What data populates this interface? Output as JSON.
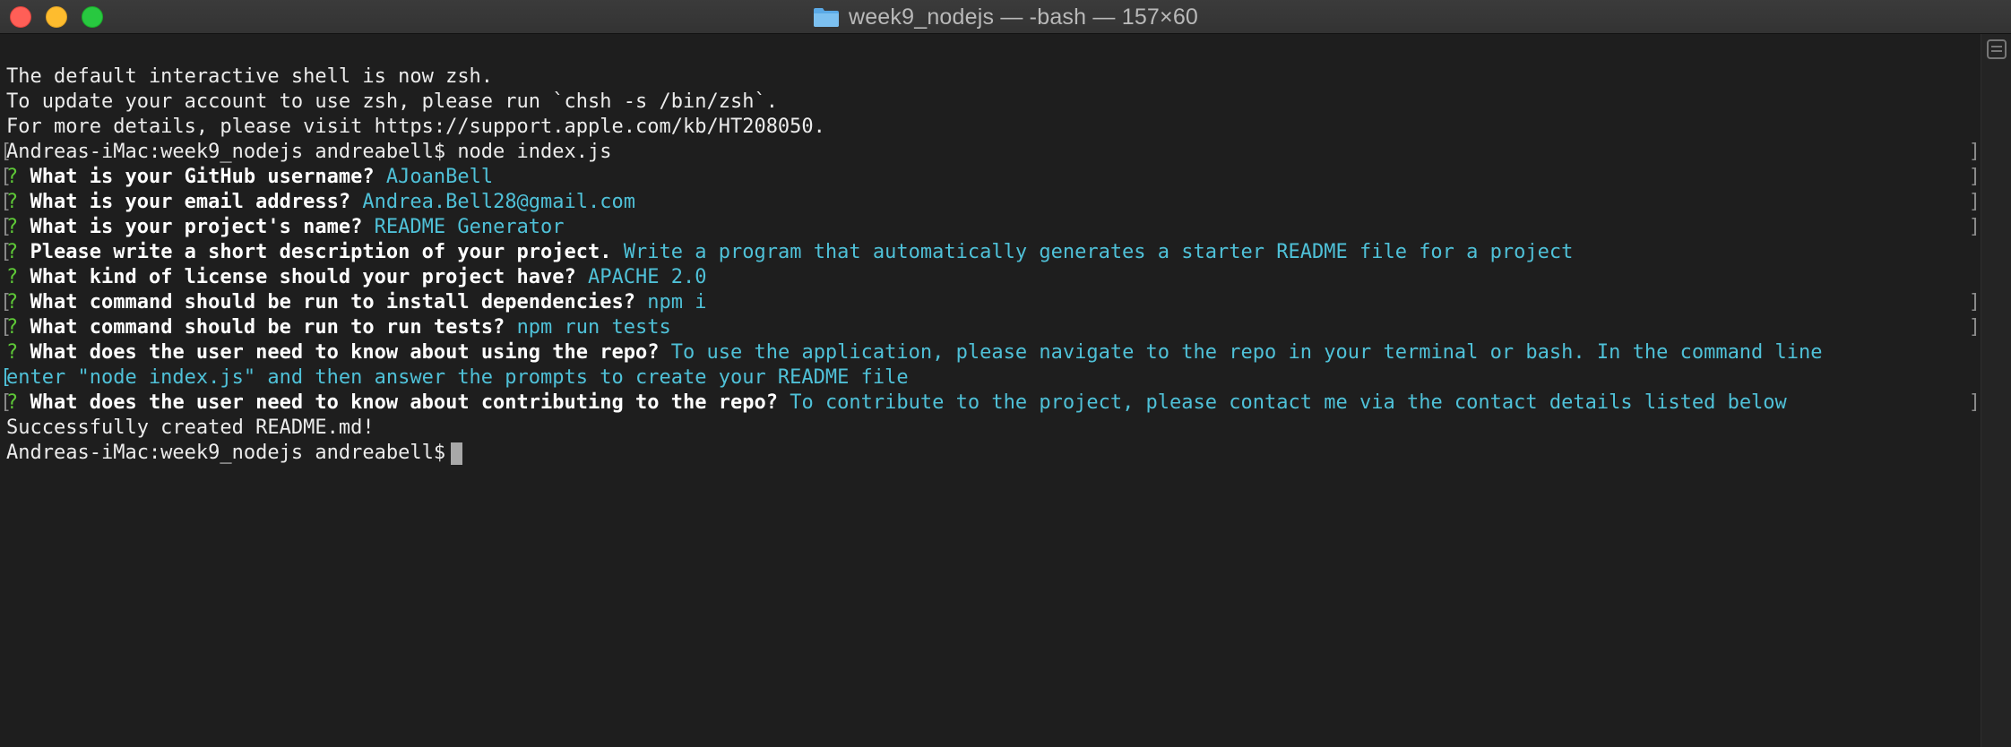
{
  "window": {
    "title": "week9_nodejs — -bash — 157×60",
    "icon": "folder-icon"
  },
  "terminal": {
    "intro": [
      "The default interactive shell is now zsh.",
      "To update your account to use zsh, please run `chsh -s /bin/zsh`.",
      "For more details, please visit https://support.apple.com/kb/HT208050."
    ],
    "command_line": "Andreas-iMac:week9_nodejs andreabell$ node index.js",
    "prompts": [
      {
        "q": "What is your GitHub username?",
        "a": "AJoanBell"
      },
      {
        "q": "What is your email address?",
        "a": "Andrea.Bell28@gmail.com"
      },
      {
        "q": "What is your project's name?",
        "a": "README Generator"
      },
      {
        "q": "Please write a short description of your project.",
        "a": "Write a program that automatically generates a starter README file for a project"
      },
      {
        "q": "What kind of license should your project have?",
        "a": "APACHE 2.0"
      },
      {
        "q": "What command should be run to install dependencies?",
        "a": "npm i"
      },
      {
        "q": "What command should be run to run tests?",
        "a": "npm run tests"
      },
      {
        "q": "What does the user need to know about using the repo?",
        "a": "To use the application, please navigate to the repo in your terminal or bash. In the command line",
        "a_cont": "enter \"node index.js\" and then answer the prompts to create your README file"
      },
      {
        "q": "What does the user need to know about contributing to the repo?",
        "a": "To contribute to the project, please contact me via the contact details listed below"
      }
    ],
    "qmark": "?",
    "success": "Successfully created README.md!",
    "final_prompt": "Andreas-iMac:week9_nodejs andreabell$",
    "colors": {
      "question_mark": "#5ec837",
      "answer": "#4fc1d8",
      "background": "#1e1e1e"
    }
  }
}
